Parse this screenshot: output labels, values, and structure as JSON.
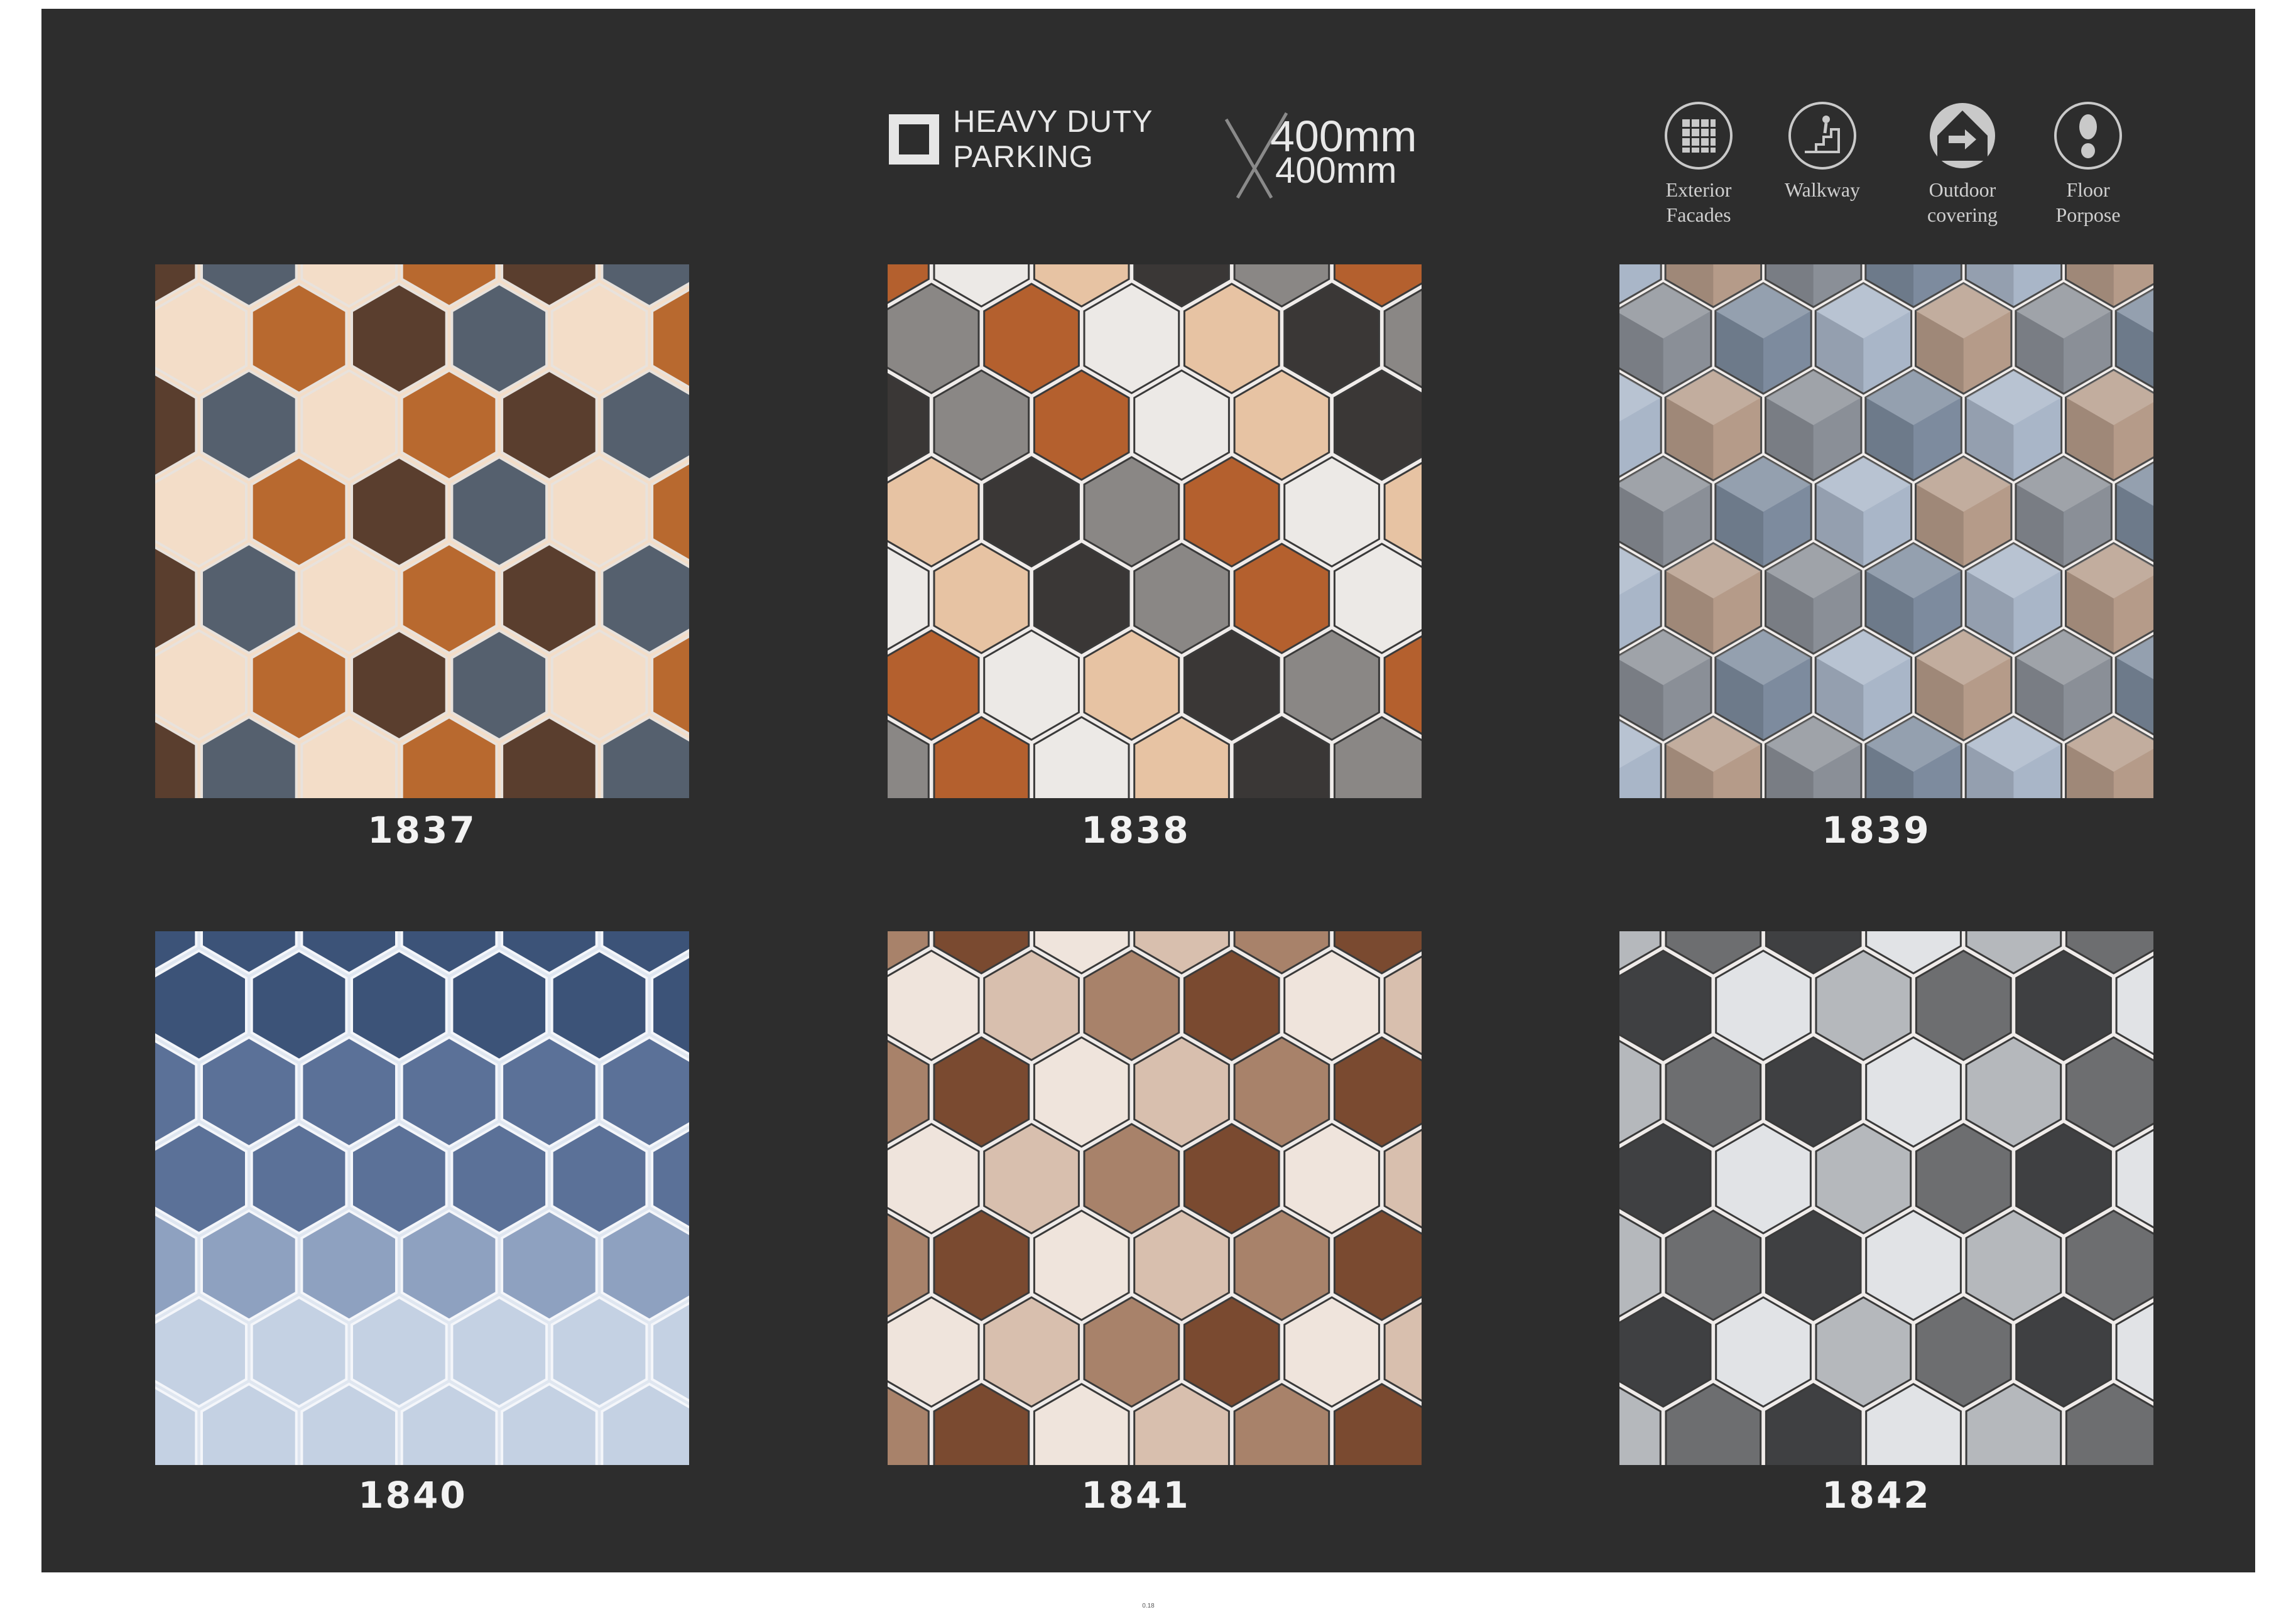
{
  "header": {
    "title": "HEAVY DUTY\nPARKING",
    "size_line1": "400mm",
    "size_line2": "400mm",
    "usage": [
      {
        "label": "Exterior\nFacades",
        "icon": "grid-icon"
      },
      {
        "label": "Walkway",
        "icon": "stairs-icon"
      },
      {
        "label": "Outdoor\ncovering",
        "icon": "house-arrow-icon"
      },
      {
        "label": "Floor\nPorpose",
        "icon": "footprint-icon"
      }
    ]
  },
  "tiles": [
    {
      "code": "1837",
      "colors": [
        "#5a3e2e",
        "#b8692f",
        "#f3ddc8",
        "#55606e"
      ]
    },
    {
      "code": "1838",
      "colors": [
        "#3a3736",
        "#b4602e",
        "#e7c3a3",
        "#8a8785",
        "#ece9e6"
      ]
    },
    {
      "code": "1839",
      "colors": [
        "#8a8f97",
        "#b59b89",
        "#a9b6c8",
        "#7d8b9e"
      ]
    },
    {
      "code": "1840",
      "colors": [
        "#3c5378",
        "#5b7198",
        "#8ea1c0",
        "#c4d1e3"
      ]
    },
    {
      "code": "1841",
      "colors": [
        "#a8826a",
        "#d8bfae",
        "#efe4dc",
        "#7a4a30"
      ]
    },
    {
      "code": "1842",
      "colors": [
        "#6d6e70",
        "#b5b8bc",
        "#e1e3e6",
        "#3f4042"
      ]
    }
  ],
  "footer": {
    "page_number": "0.18"
  }
}
